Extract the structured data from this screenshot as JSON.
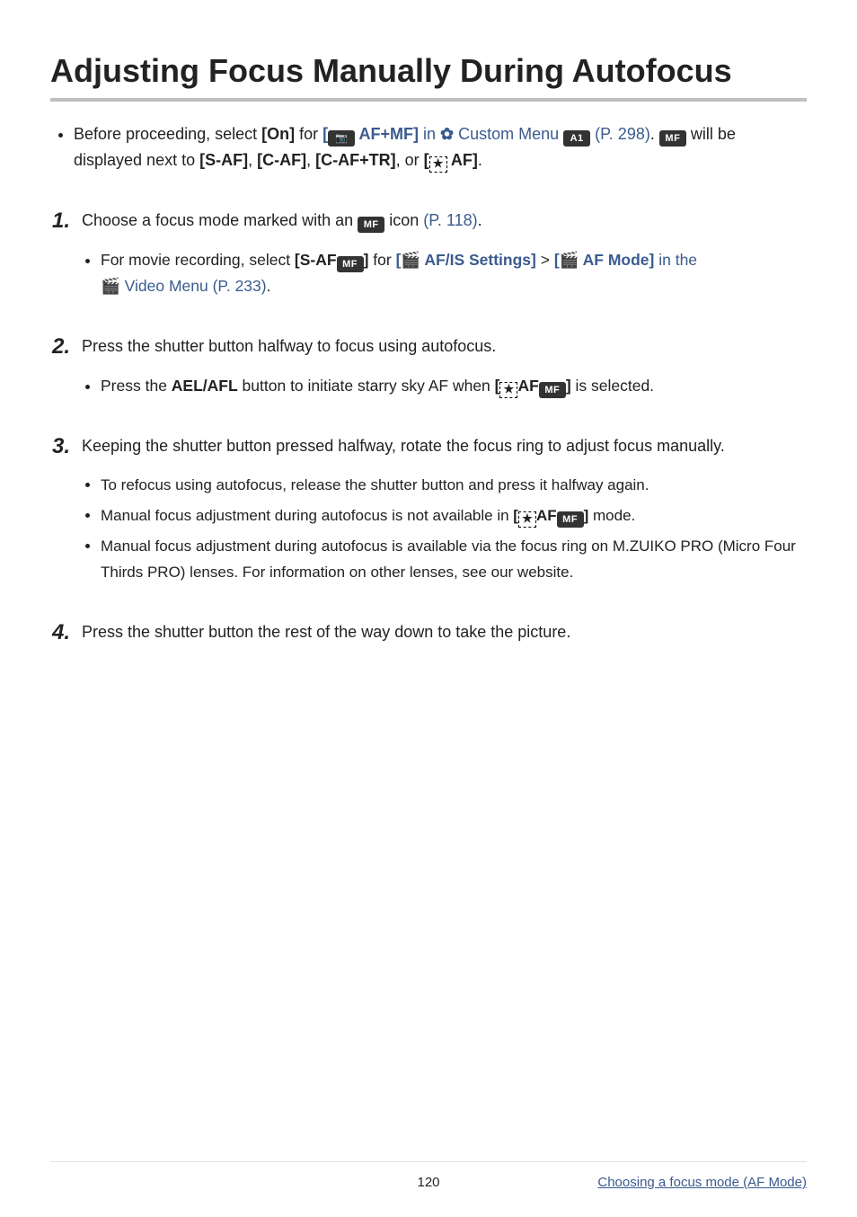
{
  "heading": "Adjusting Focus Manually During Autofocus",
  "lead": {
    "pre": "Before proceeding, select ",
    "on": "[On]",
    "for": " for ",
    "afmf_bracket_open": "[",
    "afmf_label": " AF+MF]",
    "in": " in ",
    "custom_menu": " Custom Menu ",
    "page_ref1": " (P. 298)",
    "after1": ". ",
    "after2": " will be displayed next to ",
    "saf": "[S-AF]",
    "comma1": ", ",
    "caf": "[C-AF]",
    "comma2": ", ",
    "caftr": "[C-AF+TR]",
    "or": ", or ",
    "starry_af_open": "[",
    "starry_af_label": " AF]",
    "period": "."
  },
  "steps": {
    "1": {
      "num": "1",
      "text_pre": "Choose a focus mode marked with an ",
      "text_post": " icon ",
      "page_ref": "(P. 118)",
      "end": ".",
      "sub": {
        "pre": "For movie recording, select ",
        "saf_open": "[S-AF",
        "saf_close": "]",
        "for": " for ",
        "afis_open": "[",
        "afis_label": " AF/IS Settings]",
        "gt": " > ",
        "afmode_open": "[",
        "afmode_label": " AF Mode]",
        "in": " in the ",
        "video_menu": " Video Menu (P. 233)",
        "end": "."
      }
    },
    "2": {
      "num": "2",
      "text": "Press the shutter button halfway to focus using autofocus.",
      "sub": {
        "pre": "Press the ",
        "ael": "AEL/AFL",
        "mid": " button to initiate starry sky AF when ",
        "br_open": "[",
        "af": "AF",
        "br_close": "]",
        "post": " is selected."
      }
    },
    "3": {
      "num": "3",
      "text": "Keeping the shutter button pressed halfway, rotate the focus ring to adjust focus manually.",
      "sub1": "To refocus using autofocus, release the shutter button and press it halfway again.",
      "sub2_pre": "Manual focus adjustment during autofocus is not available in ",
      "sub2_br_open": "[",
      "sub2_af": "AF",
      "sub2_br_close": "]",
      "sub2_post": " mode.",
      "sub3": "Manual focus adjustment during autofocus is available via the focus ring on M.ZUIKO PRO (Micro Four Thirds PRO) lenses. For information on other lenses, see our website."
    },
    "4": {
      "num": "4",
      "text": "Press the shutter button the rest of the way down to take the picture."
    }
  },
  "icons": {
    "mf": "MF",
    "a1": "A1",
    "gear": "✿",
    "video": "🎬"
  },
  "footer": {
    "page": "120",
    "breadcrumb": "Choosing a focus mode (AF Mode)"
  }
}
